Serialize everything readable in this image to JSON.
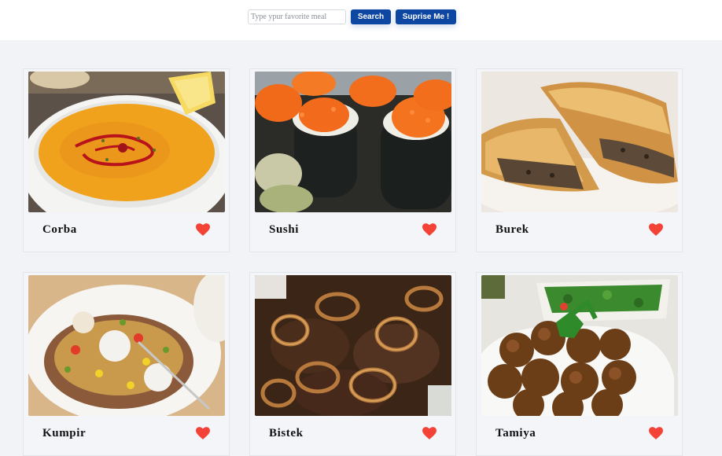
{
  "search": {
    "placeholder": "Type ypur favorite meal",
    "search_label": "Search",
    "surprise_label": "Suprise Me !"
  },
  "meals": [
    {
      "name": "Corba"
    },
    {
      "name": "Sushi"
    },
    {
      "name": "Burek"
    },
    {
      "name": "Kumpir"
    },
    {
      "name": "Bistek"
    },
    {
      "name": "Tamiya"
    }
  ],
  "colors": {
    "accent": "#0d47a1",
    "heart": "#f44336",
    "background": "#f1f3f7"
  },
  "icons": {
    "favorite": "heart-icon"
  }
}
